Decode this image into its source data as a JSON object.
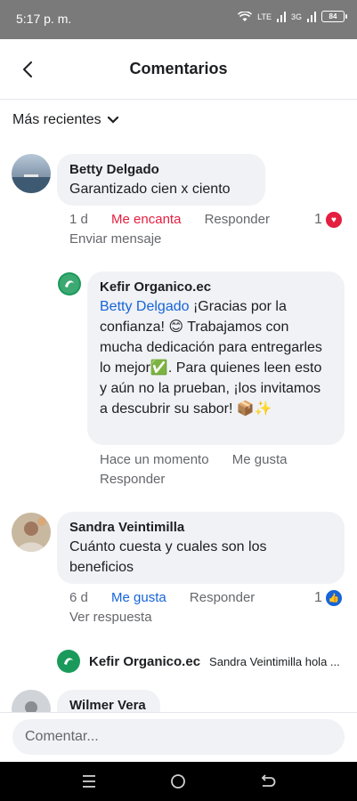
{
  "status_bar": {
    "time": "5:17 p. m.",
    "network_lte": "LTE",
    "network_3g": "3G",
    "battery": "84"
  },
  "header": {
    "title": "Comentarios"
  },
  "sort": {
    "label": "Más recientes"
  },
  "comments": [
    {
      "author": "Betty Delgado",
      "text": "Garantizado  cien x ciento",
      "time": "1 d",
      "reaction_action": "Me encanta",
      "reply_action": "Responder",
      "reaction_count": "1",
      "secondary_action": "Enviar mensaje",
      "reply": {
        "author": "Kefir Organico.ec",
        "mention": "Betty Delgado",
        "text": " ¡Gracias por la confianza! 😊 Trabajamos con mucha dedicación para entregarles lo mejor✅. Para quienes leen esto y aún no la prueban, ¡los invitamos a descubrir su sabor! 📦✨",
        "time": "Hace un momento",
        "like_action": "Me gusta",
        "reply_action": "Responder"
      }
    },
    {
      "author": "Sandra Veintimilla",
      "text": "Cuánto cuesta y cuales son los beneficios",
      "time": "6 d",
      "reaction_action": "Me gusta",
      "reply_action": "Responder",
      "reaction_count": "1",
      "secondary_action": "Ver respuesta",
      "reply_preview": {
        "author": "Kefir Organico.ec",
        "text": "Sandra Veintimilla hola ..."
      }
    },
    {
      "author": "Wilmer Vera"
    }
  ],
  "composer": {
    "placeholder": "Comentar..."
  },
  "colors": {
    "love": "#e41e3f",
    "like": "#1664d8",
    "bubble": "#f0f2f5"
  }
}
